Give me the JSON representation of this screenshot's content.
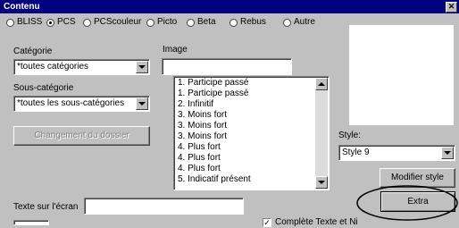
{
  "window": {
    "title": "Contenu",
    "close_glyph": "✕"
  },
  "radios": [
    {
      "label": "BLISS",
      "checked": false
    },
    {
      "label": "PCS",
      "checked": true
    },
    {
      "label": "PCScouleur",
      "checked": false
    },
    {
      "label": "Picto",
      "checked": false
    },
    {
      "label": "Beta",
      "checked": false
    },
    {
      "label": "Rebus",
      "checked": false
    },
    {
      "label": "Autre",
      "checked": false
    }
  ],
  "categorie": {
    "label": "Catégorie",
    "value": "*toutes catégories"
  },
  "image": {
    "label": "Image",
    "value": ""
  },
  "sous_categorie": {
    "label": "Sous-catégorie",
    "value": "*toutes les sous-catégories"
  },
  "change_folder_button": "Changement du dossier",
  "image_list": [
    "1. Participe passé",
    "1. Participe passé",
    "2. Infinitif",
    "3. Moins fort",
    "3. Moins fort",
    "3. Moins fort",
    "4. Plus fort",
    "4. Plus fort",
    "4. Plus fort",
    "5. Indicatif présent"
  ],
  "style": {
    "label": "Style:",
    "value": "Style 9"
  },
  "modify_style_button": "Modifier style",
  "extra_button": "Extra",
  "texte_ecran": {
    "label": "Texte sur l'écran",
    "value": ""
  },
  "complete_checkbox": {
    "label": "Complète Texte et Ni",
    "checked": true
  }
}
